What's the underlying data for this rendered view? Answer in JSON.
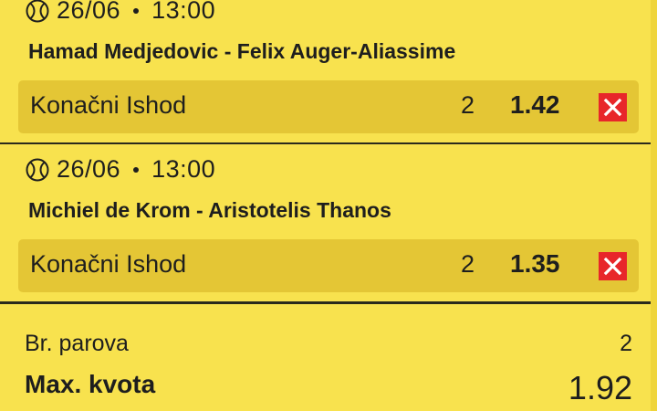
{
  "bets": [
    {
      "sport_icon": "tennis-ball-icon",
      "date": "26/06",
      "time": "13:00",
      "teams": "Hamad Medjedovic - Felix Auger-Aliassime",
      "market": "Konačni Ishod",
      "pick": "2",
      "odd": "1.42",
      "remove_icon": "close-icon"
    },
    {
      "sport_icon": "tennis-ball-icon",
      "date": "26/06",
      "time": "13:00",
      "teams": "Michiel de Krom - Aristotelis Thanos",
      "market": "Konačni Ishod",
      "pick": "2",
      "odd": "1.35",
      "remove_icon": "close-icon"
    }
  ],
  "summary": {
    "pairs_label": "Br. parova",
    "pairs_value": "2",
    "max_odd_label": "Max. kvota",
    "max_odd_value": "1.92"
  },
  "colors": {
    "background": "#f8e24e",
    "bet_row": "#e4c635",
    "remove_button": "#e8262a",
    "text": "#1e1e1e"
  }
}
